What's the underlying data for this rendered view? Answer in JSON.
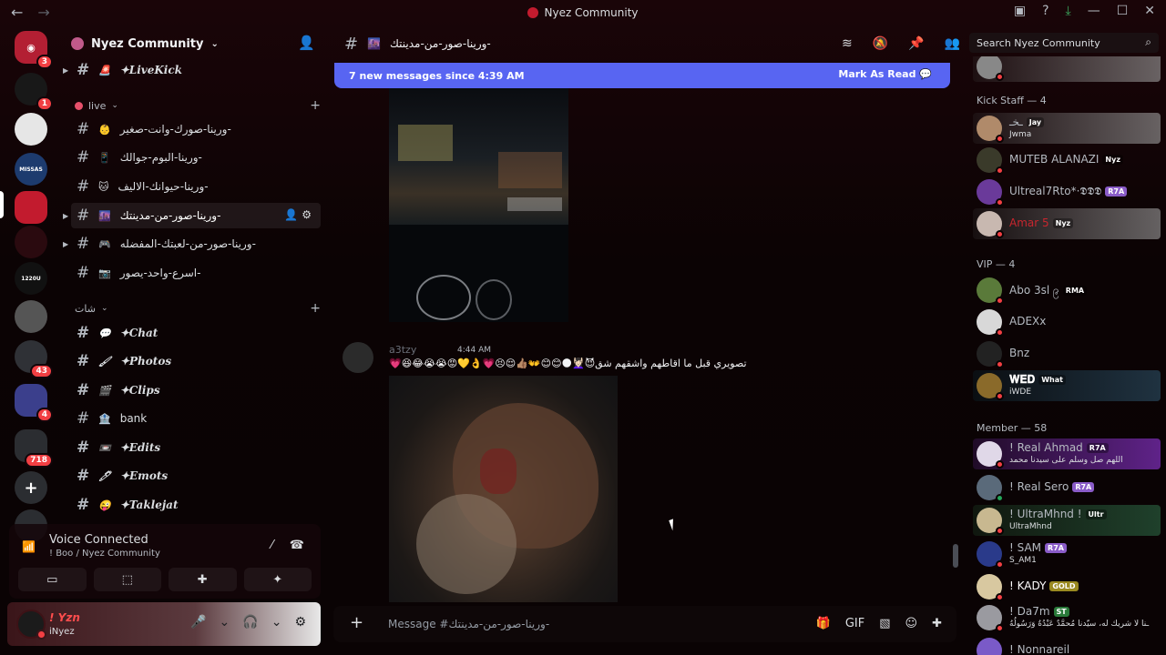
{
  "window": {
    "title": "Nyez Community"
  },
  "rail": {
    "badges": [
      "3",
      "1",
      "43",
      "4",
      "718"
    ],
    "labels": [
      "MISSAS",
      "1220U"
    ]
  },
  "guild": {
    "name": "Nyez Community",
    "channels_top": [
      "✦LiveKick"
    ],
    "category_live": "live",
    "live_channels": [
      "ورينا-صورك-وانت-صغير-",
      "ورينا-البوم-جوالك-",
      "ورينا-حيوانك-الاليف-",
      "ورينا-صور-من-مدينتك-",
      "ورينا-صور-من-لعبتك-المفضله-",
      "اسرع-واحد-يصور-"
    ],
    "category_2": "شات",
    "fancy_channels": [
      "✦Chat",
      "✦Photos",
      "✦Clips",
      "bank",
      "✦Edits",
      "✦Emots",
      "✦Taklejat"
    ]
  },
  "voice": {
    "status": "Voice Connected",
    "sub": "! Boo / Nyez Community"
  },
  "user": {
    "name": "! Yzn",
    "status": "iNyez"
  },
  "chat": {
    "channel": "ورينا-صور-من-مدينتك-",
    "new_messages": "7 new messages since 4:39 AM",
    "mark_read": "Mark As Read",
    "message": {
      "author": "a3tzy",
      "time": "4:44 AM",
      "content": "💗😆😂😭😭😡💛👌💗😣😌👍🏽👐😊😊🌑💆🏻‍♀️😈تصويري قبل ما اقاطهم واشقهم شق"
    },
    "composer_placeholder": "Message #ورينا-صور-من-مدينتك-"
  },
  "members": {
    "search_placeholder": "Search Nyez Community",
    "groups": [
      {
        "title": "Kick Staff — 4",
        "items": [
          {
            "name": "ـخـ",
            "tag": "Jay",
            "sub": "Jwma"
          },
          {
            "name": "MUTEB ALANAZI",
            "tag": "Nyz",
            "sub": ""
          },
          {
            "name": "Ultreal7Rto*·𝕯𝕯𝕯",
            "tag": "R7A",
            "sub": ""
          },
          {
            "name": "Amar 5",
            "tag": "Nyz",
            "sub": ""
          }
        ]
      },
      {
        "title": "VIP — 4",
        "items": [
          {
            "name": "Abo 3sl ၉",
            "tag": "RMA",
            "sub": ""
          },
          {
            "name": "ADEXx",
            "tag": "",
            "sub": ""
          },
          {
            "name": "Bnz",
            "tag": "",
            "sub": ""
          },
          {
            "name": "𝐖𝐄𝐃",
            "tag": "What",
            "sub": "iWDE"
          }
        ]
      },
      {
        "title": "Member — 58",
        "items": [
          {
            "name": "! Real Ahmad",
            "tag": "R7A",
            "sub": "اللهم صل وسلم على سيدنا محمد"
          },
          {
            "name": "! Real Sero",
            "tag": "R7A",
            "sub": ""
          },
          {
            "name": "! UltraMhnd !",
            "tag": "Ultr",
            "sub": "UltraMhnd"
          },
          {
            "name": "! SAM",
            "tag": "R7A",
            "sub": "S_AM1"
          },
          {
            "name": "! KADY",
            "tag": "GOLD",
            "sub": ""
          },
          {
            "name": "! Da7m",
            "tag": "ST",
            "sub": "ـنا لا شريك له، سيّدنا مُحمَّدٌ عَبْدُهُ وَرَسُولُهُ"
          },
          {
            "name": "! Nonnareil",
            "tag": "",
            "sub": ""
          }
        ]
      }
    ]
  }
}
